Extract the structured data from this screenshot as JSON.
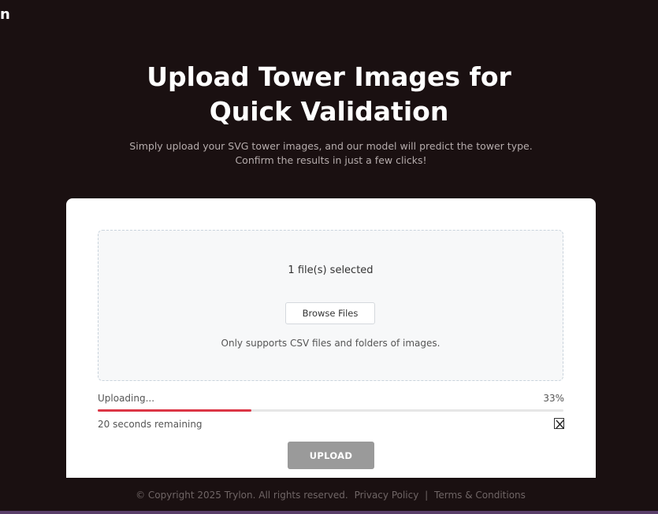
{
  "header": {
    "brand_fragment": "n"
  },
  "hero": {
    "title_line1": "Upload Tower Images for",
    "title_line2": "Quick Validation",
    "subtitle_line1": "Simply upload your SVG tower images, and our model will predict the tower type.",
    "subtitle_line2": "Confirm the results in just a few clicks!"
  },
  "upload": {
    "files_selected": "1 file(s) selected",
    "browse_label": "Browse Files",
    "support_note": "Only supports CSV files and folders of images.",
    "status_label": "Uploading...",
    "progress_text": "33%",
    "progress_fraction": 0.33,
    "time_remaining": "20 seconds remaining",
    "upload_label": "UPLOAD"
  },
  "footer": {
    "copyright": "© Copyright 2025 Trylon. All rights reserved.",
    "privacy": "Privacy Policy",
    "separator": "|",
    "terms": "Terms & Conditions"
  },
  "colors": {
    "background": "#1a1011",
    "progress_fill": "#dc3545",
    "upload_button": "#9a9a9a"
  },
  "icons": {
    "cancel": "close-icon"
  }
}
